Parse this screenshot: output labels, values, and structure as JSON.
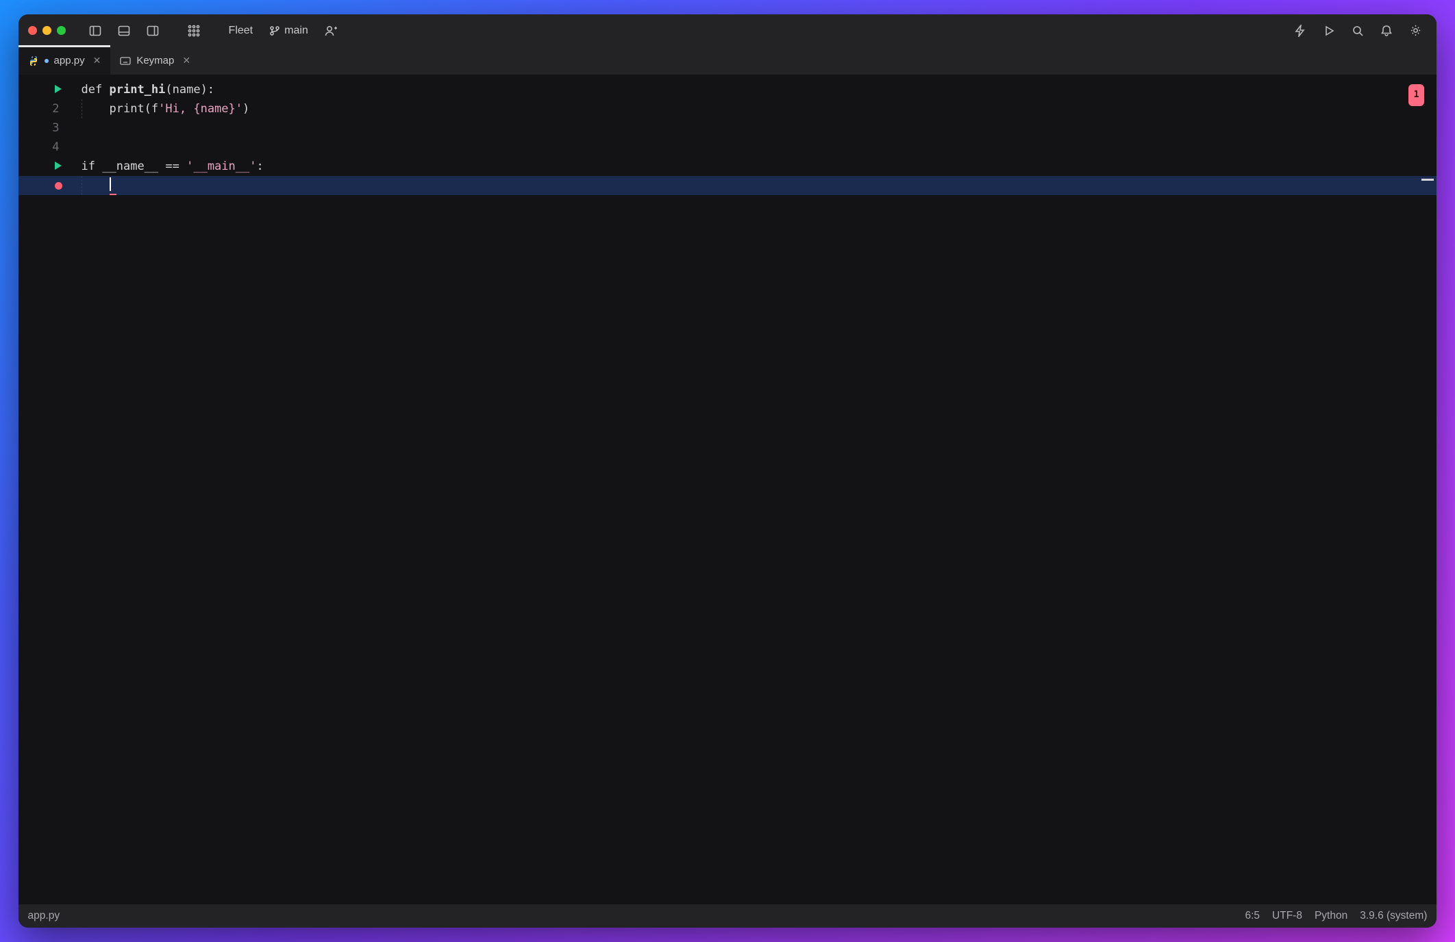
{
  "titlebar": {
    "app_menu": "Fleet",
    "branch": "main"
  },
  "tabs": [
    {
      "file_icon": "python",
      "dirty": true,
      "label": "app.py",
      "active": true
    },
    {
      "file_icon": "keyboard",
      "dirty": false,
      "label": "Keymap",
      "active": false
    }
  ],
  "gutter": [
    {
      "num": "",
      "marker": "run"
    },
    {
      "num": "2"
    },
    {
      "num": "3"
    },
    {
      "num": "4"
    },
    {
      "num": "",
      "marker": "run"
    },
    {
      "num": "",
      "marker": "breakpoint"
    }
  ],
  "code": {
    "l1_def": "def ",
    "l1_fn": "print_hi",
    "l1_rest": "(name):",
    "l2_indent": "    ",
    "l2_call": "print(",
    "l2_f": "f",
    "l2_str": "'Hi, {name}'",
    "l2_close": ")",
    "l3": "",
    "l4": "",
    "l5_if": "if ",
    "l5_name": "__name__",
    "l5_eq": " == ",
    "l5_main": "'__main__'",
    "l5_colon": ":",
    "l6_indent": "    "
  },
  "error_badge": "1",
  "status": {
    "file": "app.py",
    "pos": "6:5",
    "encoding": "UTF-8",
    "lang": "Python",
    "runtime": "3.9.6 (system)"
  },
  "icons": {
    "panel_left": "panel-left-icon",
    "panel_bottom": "panel-bottom-icon",
    "panel_right": "panel-right-icon",
    "grid": "grid-icon",
    "branch": "git-branch-icon",
    "add_user": "add-user-icon",
    "bolt": "bolt-icon",
    "play": "play-icon",
    "search": "search-icon",
    "bell": "bell-icon",
    "gear": "gear-icon"
  }
}
